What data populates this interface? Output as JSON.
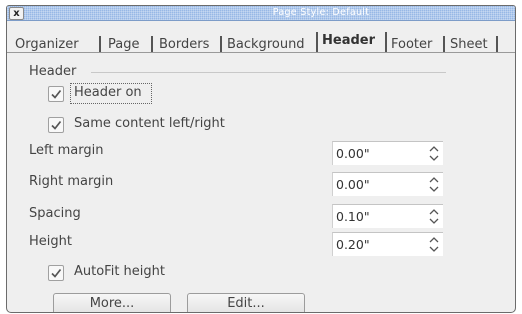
{
  "window": {
    "title": "Page Style: Default",
    "close_glyph": "x"
  },
  "tabs": [
    {
      "label": "Organizer"
    },
    {
      "label": "Page"
    },
    {
      "label": "Borders"
    },
    {
      "label": "Background"
    },
    {
      "label": "Header",
      "active": true
    },
    {
      "label": "Footer"
    },
    {
      "label": "Sheet"
    }
  ],
  "header_group": {
    "title": "Header",
    "header_on": {
      "label": "Header on",
      "checked": true
    },
    "same_content": {
      "label": "Same content left/right",
      "checked": true
    },
    "left_margin": {
      "label": "Left margin",
      "value": "0.00\""
    },
    "right_margin": {
      "label": "Right margin",
      "value": "0.00\""
    },
    "spacing": {
      "label": "Spacing",
      "value": "0.10\""
    },
    "height": {
      "label": "Height",
      "value": "0.20\""
    },
    "autofit": {
      "label": "AutoFit height",
      "checked": true
    }
  },
  "buttons": {
    "more": "More...",
    "edit": "Edit..."
  }
}
